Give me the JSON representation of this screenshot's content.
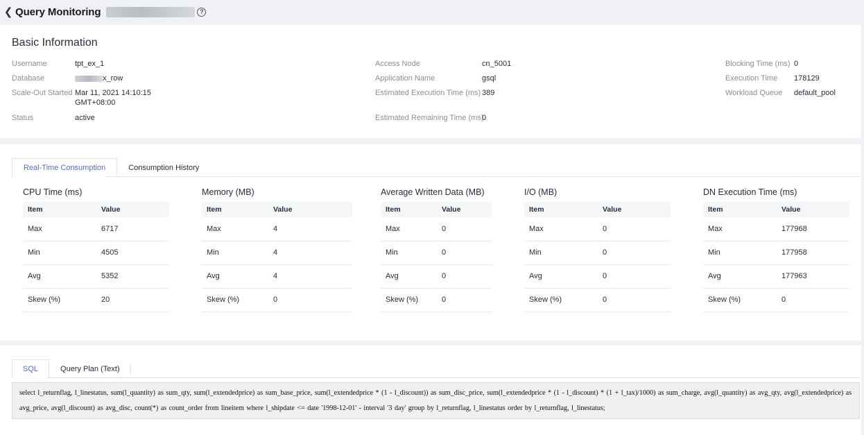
{
  "header": {
    "title": "Query Monitoring",
    "help_glyph": "?"
  },
  "basic": {
    "title": "Basic Information",
    "col1": [
      {
        "k": "Username",
        "v": "tpt_ex_1"
      },
      {
        "k": "Database",
        "v": "x_row"
      },
      {
        "k": "Scale-Out Started",
        "v": "Mar 11, 2021 14:10:15",
        "v2": "GMT+08:00"
      },
      {
        "k": "Status",
        "v": "active"
      }
    ],
    "col2": [
      {
        "k": "Access Node",
        "v": "cn_5001"
      },
      {
        "k": "Application Name",
        "v": "gsql"
      },
      {
        "k": "Estimated Execution Time (ms)",
        "v": "389"
      },
      {
        "k": "Estimated Remaining Time (ms)",
        "v": "0"
      }
    ],
    "col3": [
      {
        "k": "Blocking Time (ms)",
        "v": "0"
      },
      {
        "k": "Execution Time",
        "v": "178129"
      },
      {
        "k": "Workload Queue",
        "v": "default_pool"
      }
    ]
  },
  "consume_tabs": [
    "Real-Time Consumption",
    "Consumption History"
  ],
  "metrics": [
    {
      "title": "CPU Time (ms)",
      "h1": "Item",
      "h2": "Value",
      "rows": [
        [
          "Max",
          "6717"
        ],
        [
          "Min",
          "4505"
        ],
        [
          "Avg",
          "5352"
        ],
        [
          "Skew (%)",
          "20"
        ]
      ]
    },
    {
      "title": "Memory (MB)",
      "h1": "Item",
      "h2": "Value",
      "rows": [
        [
          "Max",
          "4"
        ],
        [
          "Min",
          "4"
        ],
        [
          "Avg",
          "4"
        ],
        [
          "Skew (%)",
          "0"
        ]
      ]
    },
    {
      "title": "Average Written Data (MB)",
      "h1": "Item",
      "h2": "Value",
      "rows": [
        [
          "Max",
          "0"
        ],
        [
          "Min",
          "0"
        ],
        [
          "Avg",
          "0"
        ],
        [
          "Skew (%)",
          "0"
        ]
      ]
    },
    {
      "title": "I/O (MB)",
      "h1": "Item",
      "h2": "Value",
      "rows": [
        [
          "Max",
          "0"
        ],
        [
          "Min",
          "0"
        ],
        [
          "Avg",
          "0"
        ],
        [
          "Skew (%)",
          "0"
        ]
      ]
    },
    {
      "title": "DN Execution Time (ms)",
      "h1": "Item",
      "h2": "Value",
      "rows": [
        [
          "Max",
          "177968"
        ],
        [
          "Min",
          "177958"
        ],
        [
          "Avg",
          "177963"
        ],
        [
          "Skew (%)",
          "0"
        ]
      ]
    }
  ],
  "sql_tabs": [
    "SQL",
    "Query Plan (Text)"
  ],
  "sql_text": "select l_returnflag, l_linestatus, sum(l_quantity) as sum_qty, sum(l_extendedprice) as sum_base_price, sum(l_extendedprice * (1 - l_discount)) as sum_disc_price, sum(l_extendedprice * (1 - l_discount) * (1 + l_tax)/1000) as sum_charge, avg(l_quantity) as avg_qty, avg(l_extendedprice) as avg_price, avg(l_discount) as avg_disc, count(*) as count_order from lineitem where l_shipdate <= date '1998-12-01' - interval '3 day' group by l_returnflag, l_linestatus order by l_returnflag, l_linestatus;"
}
